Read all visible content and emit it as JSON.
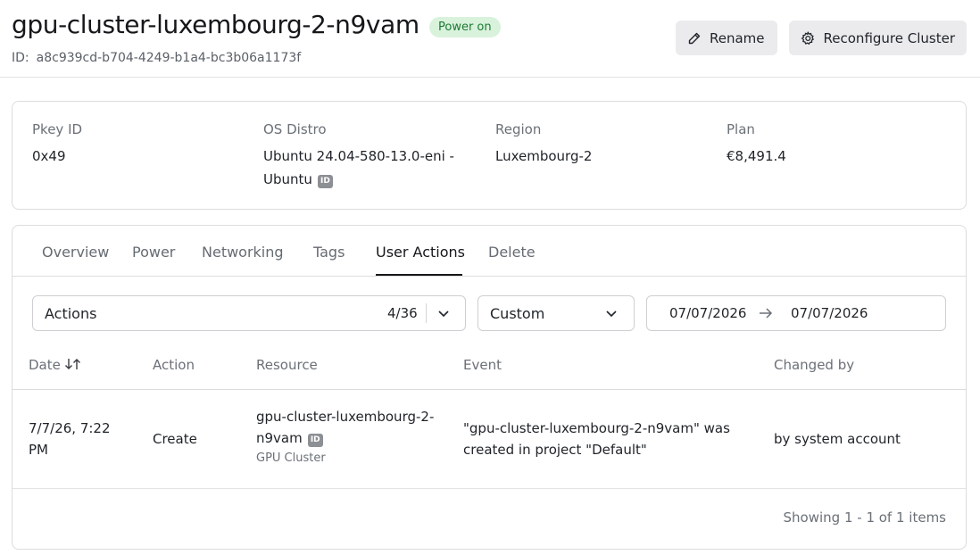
{
  "header": {
    "title": "gpu-cluster-luxembourg-2-n9vam",
    "status_badge": "Power on",
    "id_label": "ID:",
    "id_value": "a8c939cd-b704-4249-b1a4-bc3b06a1173f",
    "rename_label": "Rename",
    "reconfigure_label": "Reconfigure Cluster"
  },
  "info": {
    "pkey": {
      "label": "Pkey ID",
      "value": "0x49"
    },
    "os": {
      "label": "OS Distro",
      "value_line1": "Ubuntu 24.04-580-13.0-eni -",
      "value_line2": "Ubuntu",
      "chip": "ID"
    },
    "region": {
      "label": "Region",
      "value": "Luxembourg-2"
    },
    "plan": {
      "label": "Plan",
      "value": "€8,491.4"
    }
  },
  "tabs": [
    {
      "label": "Overview"
    },
    {
      "label": "Power"
    },
    {
      "label": "Networking"
    },
    {
      "label": "Tags"
    },
    {
      "label": "User Actions",
      "active": true
    },
    {
      "label": "Delete"
    }
  ],
  "filters": {
    "actions_label": "Actions",
    "actions_count": "4/36",
    "range_select": "Custom",
    "date_from": "07/07/2026",
    "date_to": "07/07/2026"
  },
  "table": {
    "columns": [
      "Date",
      "Action",
      "Resource",
      "Event",
      "Changed by"
    ],
    "rows": [
      {
        "date_line1": "7/7/26, 7:22",
        "date_line2": "PM",
        "action": "Create",
        "resource_line1": "gpu-cluster-luxembourg-2-",
        "resource_line2": "n9vam",
        "resource_chip": "ID",
        "resource_type": "GPU Cluster",
        "event_line1": "\"gpu-cluster-luxembourg-2-n9vam\" was",
        "event_line2": "created in project \"Default\"",
        "changed_by": "by system account"
      }
    ]
  },
  "footer": {
    "summary": "Showing 1 - 1 of 1 items"
  },
  "colors": {
    "badge_bg": "#d9f2dc",
    "badge_text": "#1f7a34",
    "button_bg": "#ebebee",
    "border": "#dcdcdc"
  }
}
